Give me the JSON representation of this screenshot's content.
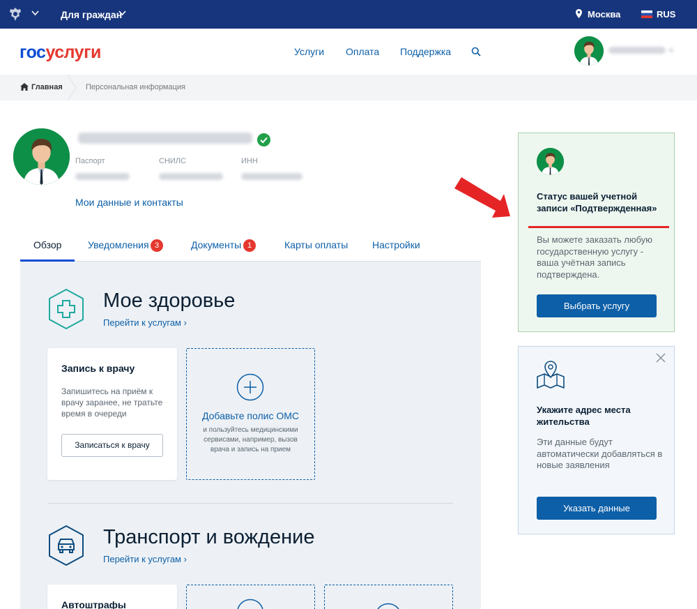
{
  "topbar": {
    "role": "Для граждан",
    "location": "Москва",
    "language": "RUS"
  },
  "header": {
    "logo_part1": "гос",
    "logo_part2": "услуги",
    "nav": [
      "Услуги",
      "Оплата",
      "Поддержка"
    ]
  },
  "breadcrumb": {
    "home": "Главная",
    "current": "Персональная информация"
  },
  "profile": {
    "labels": [
      "Паспорт",
      "СНИЛС",
      "ИНН"
    ],
    "my_data_link": "Мои данные и контакты"
  },
  "tabs": [
    {
      "label": "Обзор"
    },
    {
      "label": "Уведомления",
      "badge": "3"
    },
    {
      "label": "Документы",
      "badge": "1"
    },
    {
      "label": "Карты оплаты"
    },
    {
      "label": "Настройки"
    }
  ],
  "health": {
    "title": "Мое здоровье",
    "link": "Перейти к услугам",
    "doctor_card": {
      "title": "Запись к врачу",
      "text": "Запишитесь на приём к врачу заранее, не тратьте время в очереди",
      "button": "Записаться к врачу"
    },
    "oms_card": {
      "title": "Добавьте полис ОМС",
      "text": "и пользуйтесь медицинскими сервисами, например, вызов врача и запись на прием"
    }
  },
  "transport": {
    "title": "Транспорт и вождение",
    "link": "Перейти к услугам",
    "fines_card": {
      "title": "Автоштрафы"
    }
  },
  "status_card": {
    "title": "Статус вашей учетной записи «Подтвержденная»",
    "text": "Вы можете заказать любую государственную услугу - ваша учётная запись подтверждена.",
    "button": "Выбрать услугу"
  },
  "address_card": {
    "title": "Укажите адрес места жительства",
    "text": "Эти данные будут автоматически добавляться в новые заявления",
    "button": "Указать данные"
  },
  "colors": {
    "topbar": "#17357c",
    "logo_blue": "#0d4cd3",
    "logo_red": "#e5382f",
    "link": "#0d5fa7",
    "primary_button": "#0d5fa7",
    "badge": "#e5382f",
    "verified": "#21a04a",
    "arrow": "#e52426"
  }
}
